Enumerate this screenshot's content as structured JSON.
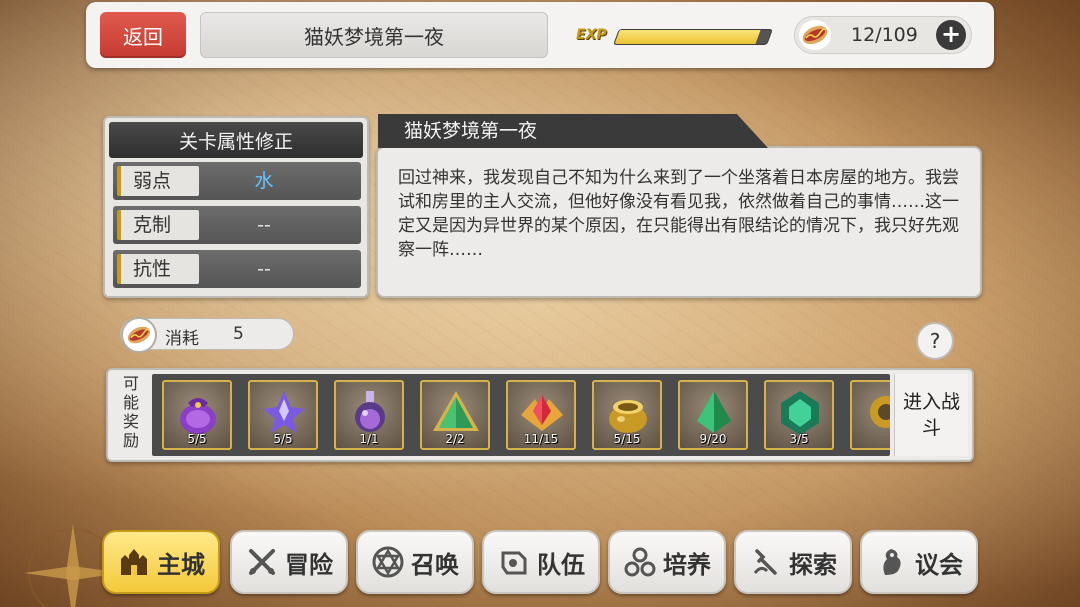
{
  "header": {
    "back_label": "返回",
    "stage_title": "猫妖梦境第一夜",
    "exp_label": "EXP",
    "exp_fraction": 0.93,
    "stamina_text": "12/109",
    "plus_label": "+"
  },
  "attributes": {
    "title": "关卡属性修正",
    "rows": [
      {
        "label": "弱点",
        "value": "水"
      },
      {
        "label": "克制",
        "value": "--"
      },
      {
        "label": "抗性",
        "value": "--"
      }
    ]
  },
  "description": {
    "title": "猫妖梦境第一夜",
    "text": "回过神来，我发现自己不知为什么来到了一个坐落着日本房屋的地方。我尝试和房里的主人交流，但他好像没有看见我，依然做着自己的事情……这一定又是因为异世界的某个原因，在只能得出有限结论的情况下，我只好先观察一阵……"
  },
  "cost": {
    "label": "消耗",
    "value": "5"
  },
  "help_label": "?",
  "rewards": {
    "label": "可能奖励",
    "items": [
      {
        "count": "5/5",
        "icon": "purple-pouch-icon"
      },
      {
        "count": "5/5",
        "icon": "purple-crystal-icon"
      },
      {
        "count": "1/1",
        "icon": "potion-flask-icon"
      },
      {
        "count": "2/2",
        "icon": "green-pyramid-gem-icon"
      },
      {
        "count": "11/15",
        "icon": "red-crystal-icon"
      },
      {
        "count": "5/15",
        "icon": "gold-pot-icon"
      },
      {
        "count": "9/20",
        "icon": "green-shard-icon"
      },
      {
        "count": "3/5",
        "icon": "green-cube-gem-icon"
      }
    ],
    "battle_label": "进入战斗"
  },
  "nav": [
    {
      "label": "主城",
      "icon": "castle-icon",
      "active": true
    },
    {
      "label": "冒险",
      "icon": "crossed-swords-icon",
      "active": false
    },
    {
      "label": "召唤",
      "icon": "summon-circle-icon",
      "active": false
    },
    {
      "label": "队伍",
      "icon": "team-icon",
      "active": false
    },
    {
      "label": "培养",
      "icon": "cultivate-icon",
      "active": false
    },
    {
      "label": "探索",
      "icon": "explore-icon",
      "active": false
    },
    {
      "label": "议会",
      "icon": "council-icon",
      "active": false
    }
  ],
  "colors": {
    "back_button": "#d24a3f",
    "exp_fill": "#f0cc45",
    "active_nav": "#f6d251",
    "weakness_water": "#62c6ff"
  }
}
